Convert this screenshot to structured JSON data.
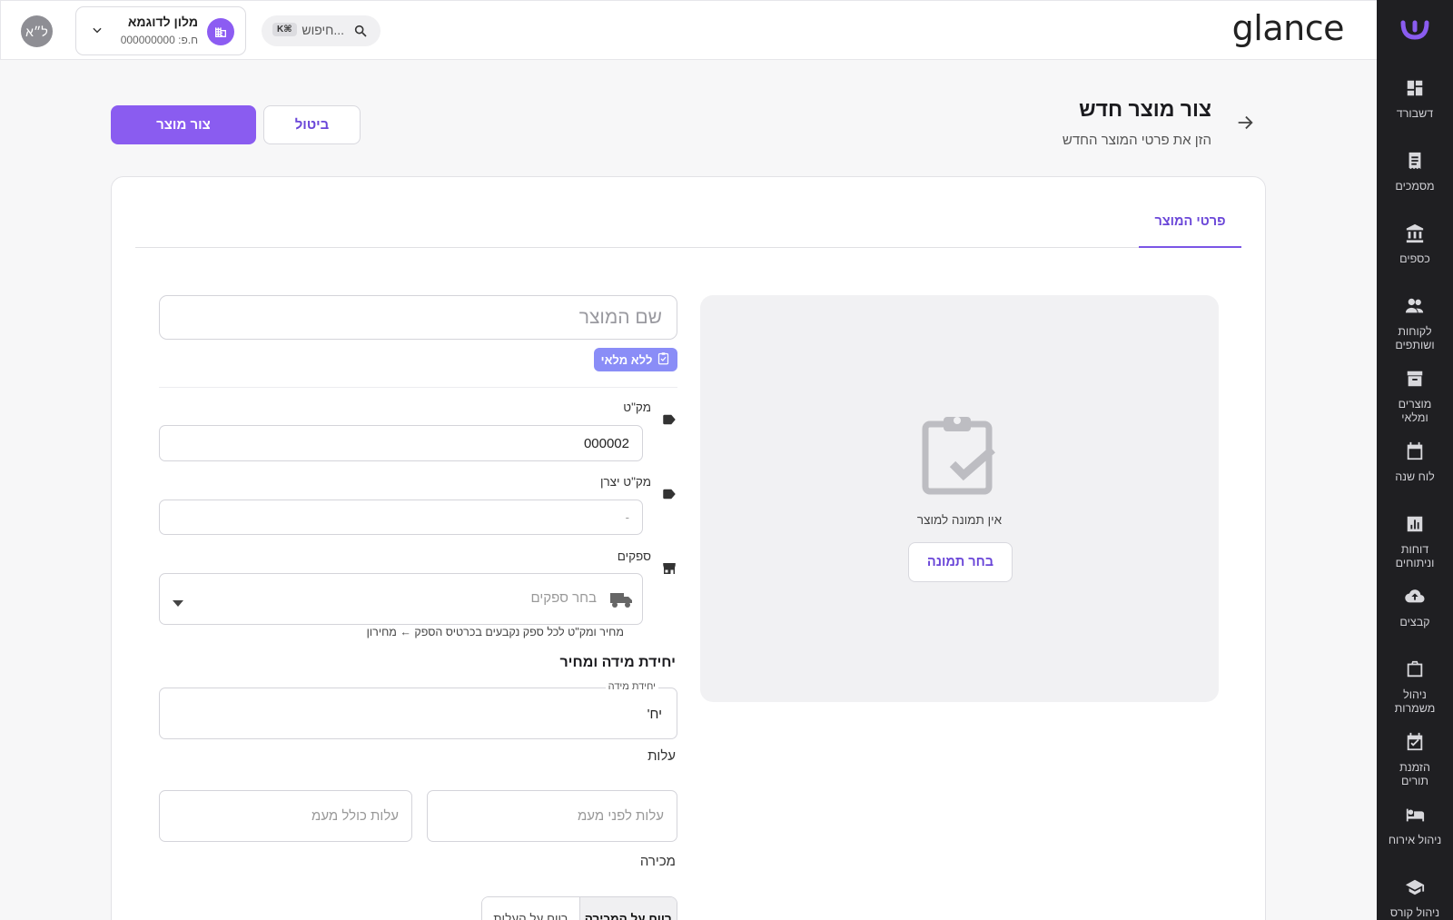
{
  "brand": {
    "name": "glance"
  },
  "topbar": {
    "avatar_initials": "ל״א",
    "org": {
      "name": "מלון לדוגמא",
      "id_line": "ח.פ: 000000000"
    },
    "search": {
      "placeholder": "חיפוש...",
      "shortcut": "K⌘"
    }
  },
  "sidebar": {
    "items": [
      {
        "label": "דשבורד",
        "icon": "dashboard-icon"
      },
      {
        "label": "מסמכים",
        "icon": "documents-icon"
      },
      {
        "label": "כספים",
        "icon": "bank-icon"
      },
      {
        "label": "לקוחות ושותפים",
        "icon": "people-icon"
      },
      {
        "label": "מוצרים ומלאי",
        "icon": "archive-icon"
      },
      {
        "label": "לוח שנה",
        "icon": "calendar-icon"
      },
      {
        "label": "דוחות וניתוחים",
        "icon": "report-icon"
      },
      {
        "label": "קבצים",
        "icon": "cloud-upload-icon"
      },
      {
        "label": "ניהול משמרות",
        "icon": "briefcase-icon"
      },
      {
        "label": "הזמנת תורים",
        "icon": "calendar-check-icon"
      },
      {
        "label": "ניהול אירוח",
        "icon": "bed-icon"
      },
      {
        "label": "ניהול קורס",
        "icon": "school-icon"
      }
    ]
  },
  "header": {
    "title": "צור מוצר חדש",
    "subtitle": "הזן את פרטי המוצר החדש",
    "cancel_label": "ביטול",
    "create_label": "צור מוצר"
  },
  "tabs": {
    "active": "פרטי המוצר"
  },
  "image_panel": {
    "no_image_text": "אין תמונה למוצר",
    "choose_label": "בחר תמונה"
  },
  "form": {
    "name_placeholder": "שם המוצר",
    "no_stock_chip": "ללא מלאי",
    "sku": {
      "label": "מק\"ט",
      "value": "000002"
    },
    "manufacturer_sku": {
      "label": "מק\"ט יצרן",
      "placeholder": "-"
    },
    "suppliers": {
      "label": "ספקים",
      "placeholder": "בחר ספקים",
      "helper": "מחיר ומק\"ט לכל ספק נקבעים בכרטיס הספק ← מחירון"
    },
    "unit_section": {
      "title": "יחידת מידה ומחיר",
      "unit_label": "יחידת מידה",
      "unit_value": "יח'"
    },
    "cost": {
      "label": "עלות",
      "before_vat_placeholder": "עלות לפני מעמ",
      "incl_vat_placeholder": "עלות כולל מעמ"
    },
    "sale": {
      "label": "מכירה",
      "option_sale": "רווח על המכירה",
      "option_cost": "רווח על העלות"
    }
  },
  "colors": {
    "accent": "#8a5cf0",
    "sidebar_bg": "#1f1f22",
    "chip": "#8a8df7"
  }
}
